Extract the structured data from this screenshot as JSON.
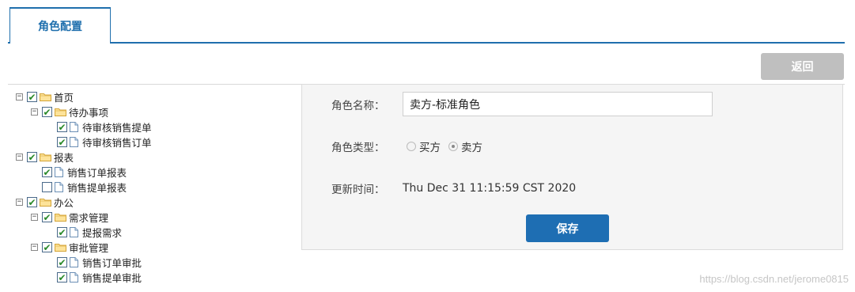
{
  "tab": {
    "label": "角色配置"
  },
  "back_button": {
    "label": "返回"
  },
  "tree": {
    "nodes": [
      {
        "label": "首页",
        "checked": true,
        "type": "folder",
        "level": 0,
        "expanded": true
      },
      {
        "label": "待办事项",
        "checked": true,
        "type": "folder",
        "level": 1,
        "expanded": true
      },
      {
        "label": "待审核销售提单",
        "checked": true,
        "type": "doc",
        "level": 2
      },
      {
        "label": "待审核销售订单",
        "checked": true,
        "type": "doc",
        "level": 2
      },
      {
        "label": "报表",
        "checked": true,
        "type": "folder",
        "level": 0,
        "expanded": true
      },
      {
        "label": "销售订单报表",
        "checked": true,
        "type": "doc",
        "level": 1
      },
      {
        "label": "销售提单报表",
        "checked": false,
        "type": "doc",
        "level": 1
      },
      {
        "label": "办公",
        "checked": true,
        "type": "folder",
        "level": 0,
        "expanded": true
      },
      {
        "label": "需求管理",
        "checked": true,
        "type": "folder",
        "level": 1,
        "expanded": true
      },
      {
        "label": "提报需求",
        "checked": true,
        "type": "doc",
        "level": 2
      },
      {
        "label": "审批管理",
        "checked": true,
        "type": "folder",
        "level": 1,
        "expanded": true
      },
      {
        "label": "销售订单审批",
        "checked": true,
        "type": "doc",
        "level": 2
      },
      {
        "label": "销售提单审批",
        "checked": true,
        "type": "doc",
        "level": 2
      }
    ]
  },
  "form": {
    "name_label": "角色名称：",
    "name_value": "卖方-标准角色",
    "type_label": "角色类型：",
    "type_options": [
      {
        "label": "买方",
        "selected": false
      },
      {
        "label": "卖方",
        "selected": true
      }
    ],
    "updated_label": "更新时间：",
    "updated_value": "Thu Dec 31 11:15:59 CST 2020",
    "save_label": "保存"
  },
  "watermark": "https://blog.csdn.net/jerome0815",
  "colors": {
    "accent": "#1f6fad",
    "save_button": "#1e6eb3",
    "back_button": "#bfbfbf",
    "panel_bg": "#f5f5f5"
  },
  "icons": {
    "expander": "minus-box-icon",
    "folder": "folder-icon",
    "doc": "document-icon",
    "check": "checkbox-icon"
  }
}
